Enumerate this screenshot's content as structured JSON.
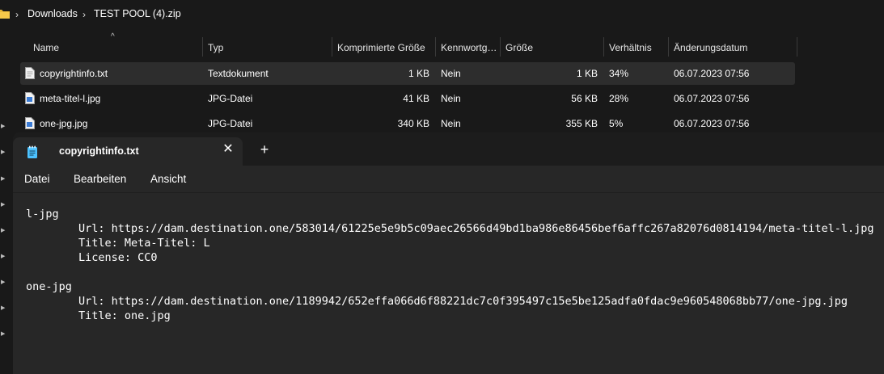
{
  "breadcrumb": {
    "items": [
      "Downloads",
      "TEST POOL (4).zip"
    ]
  },
  "columns": {
    "name": "Name",
    "type": "Typ",
    "compressed": "Komprimierte Größe",
    "password": "Kennwortg…",
    "size": "Größe",
    "ratio": "Verhältnis",
    "modified": "Änderungsdatum"
  },
  "files": [
    {
      "name": "copyrightinfo.txt",
      "type": "Textdokument",
      "compressed": "1 KB",
      "password": "Nein",
      "size": "1 KB",
      "ratio": "34%",
      "modified": "06.07.2023 07:56",
      "icon": "text-file-icon"
    },
    {
      "name": "meta-titel-l.jpg",
      "type": "JPG-Datei",
      "compressed": "41 KB",
      "password": "Nein",
      "size": "56 KB",
      "ratio": "28%",
      "modified": "06.07.2023 07:56",
      "icon": "image-file-icon"
    },
    {
      "name": "one-jpg.jpg",
      "type": "JPG-Datei",
      "compressed": "340 KB",
      "password": "Nein",
      "size": "355 KB",
      "ratio": "5%",
      "modified": "06.07.2023 07:56",
      "icon": "image-file-icon"
    }
  ],
  "notepad": {
    "tab_title": "copyrightinfo.txt",
    "close_glyph": "✕",
    "new_tab_glyph": "+",
    "menu": [
      "Datei",
      "Bearbeiten",
      "Ansicht"
    ],
    "lines": [
      "l-jpg",
      "        Url: https://dam.destination.one/583014/61225e5e9b5c09aec26566d49bd1ba986e86456bef6affc267a82076d0814194/meta-titel-l.jpg",
      "        Title: Meta-Titel: L",
      "        License: CC0",
      "",
      "one-jpg",
      "        Url: https://dam.destination.one/1189942/652effa066d6f88221dc7c0f395497c15e5be125adfa0fdac9e960548068bb77/one-jpg.jpg",
      "        Title: one.jpg"
    ]
  },
  "colors": {
    "background": "#191919",
    "selected_row": "#2d2d2d",
    "notepad_bg": "#272727",
    "notepad_icon": "#4cc2ff"
  }
}
